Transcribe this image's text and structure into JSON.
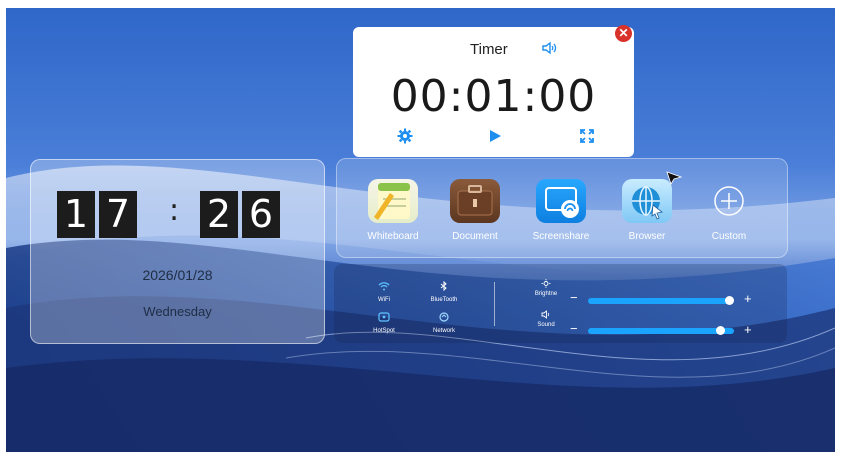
{
  "clock": {
    "hour_d1": "1",
    "hour_d2": "7",
    "separator": ":",
    "min_d1": "2",
    "min_d2": "6",
    "date": "2026/01/28",
    "weekday": "Wednesday"
  },
  "timer": {
    "title": "Timer",
    "time": "00:01:00",
    "sound_icon": "speaker-icon",
    "close_icon": "close-icon",
    "close_glyph": "✕",
    "settings_icon": "gear-icon",
    "play_icon": "play-icon",
    "fullscreen_icon": "fullscreen-icon"
  },
  "apps": [
    {
      "label": "Whiteboard",
      "icon": "whiteboard-icon"
    },
    {
      "label": "Document",
      "icon": "briefcase-icon"
    },
    {
      "label": "Screenshare",
      "icon": "screenshare-icon"
    },
    {
      "label": "Browser",
      "icon": "globe-icon"
    },
    {
      "label": "Custom",
      "icon": "plus-circle-icon"
    }
  ],
  "quick_settings": [
    {
      "label": "WiFi",
      "icon": "wifi-icon"
    },
    {
      "label": "BlueTooth",
      "icon": "bluetooth-icon"
    },
    {
      "label": "HotSpot",
      "icon": "hotspot-icon"
    },
    {
      "label": "Network",
      "icon": "network-icon"
    }
  ],
  "sliders": {
    "brightness": {
      "label": "Brightne",
      "icon": "sun-icon",
      "minus": "−",
      "plus": "+",
      "level": 1.0
    },
    "sound": {
      "label": "Sound",
      "icon": "speaker-icon",
      "minus": "−",
      "plus": "+",
      "level": 0.94
    }
  },
  "colors": {
    "accent": "#1aa3ff",
    "timer_accent": "#1e8ff0",
    "close_red": "#d9322b",
    "digit_bg": "#1c1c1c"
  }
}
